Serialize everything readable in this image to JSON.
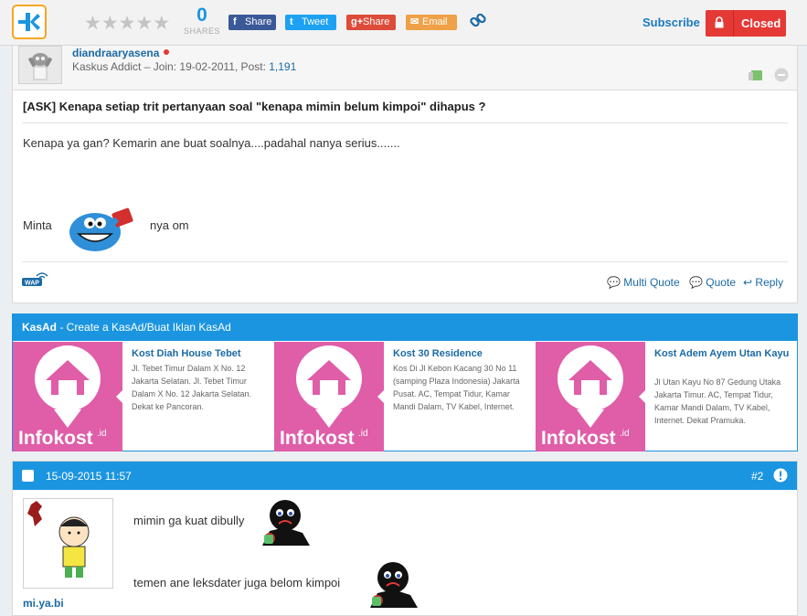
{
  "topbar": {
    "logo": "kaskus-logo-icon",
    "rating_stars": 5,
    "rating_filled": 0,
    "share_count": "0",
    "share_label": "SHARES",
    "share_buttons": {
      "facebook": "Share",
      "twitter": "Tweet",
      "googleplus": "Share",
      "email": "Email"
    },
    "link_icon": "link-icon",
    "subscribe": "Subscribe",
    "closed": "Closed"
  },
  "post1": {
    "username": "diandraaryasena",
    "meta": "Kaskus Addict – Join: 19-02-2011, Post: ",
    "post_count": "1,191",
    "title": "[ASK] Kenapa setiap trit pertanyaan soal \"kenapa mimin belum kimpoi\" dihapus ?",
    "body": "Kenapa ya gan? Kemarin ane buat soalnya....padahal nanya serius.......",
    "minta": "Minta",
    "nya_om": "nya om",
    "wap": "WAP",
    "actions": {
      "multi_quote": "Multi Quote",
      "quote": "Quote",
      "reply": "Reply"
    }
  },
  "kasad": {
    "title": "KasAd",
    "subtitle": " - Create a KasAd/Buat Iklan KasAd",
    "ads": [
      {
        "brand": "Infokost",
        "brand_suffix": ".id",
        "title": "Kost Diah House Tebet",
        "desc": "Jl. Tebet Timur Dalam X No. 12 Jakarta Selatan. Jl. Tebet Timur Dalam X No. 12 Jakarta Selatan. Dekat ke Pancoran."
      },
      {
        "brand": "Infokost",
        "brand_suffix": ".id",
        "title": "Kost 30 Residence",
        "desc": "Kos Di Jl Kebon Kacang 30 No 11 (samping Plaza Indonesia) Jakarta Pusat. AC, Tempat Tidur, Kamar Mandi Dalam, TV Kabel, Internet."
      },
      {
        "brand": "Infokost",
        "brand_suffix": ".id",
        "title": "Kost Adem Ayem Utan Kayu",
        "desc": "Jl Utan Kayu No 87 Gedung Utaka Jakarta Timur. AC, Tempat Tidur, Kamar Mandi Dalam, TV Kabel, Internet. Dekat Pramuka."
      }
    ]
  },
  "post2": {
    "date": "15-09-2015 11:57",
    "number": "#2",
    "username": "mi.ya.bi",
    "line1": "mimin ga kuat dibully",
    "line2": "temen ane leksdater juga belom kimpoi"
  },
  "colors": {
    "accent_blue": "#1b95e0",
    "closed_red": "#e53935",
    "logo_orange": "#f5a623",
    "ad_pink": "#e05da8"
  }
}
